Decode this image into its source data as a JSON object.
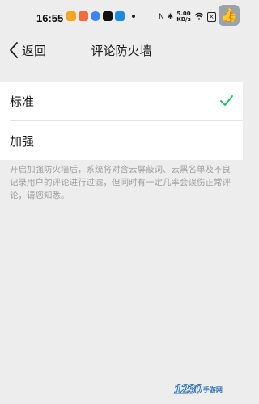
{
  "status_bar": {
    "time": "16:55",
    "network_speed": "5.00\nKB/s",
    "battery": "32"
  },
  "nav": {
    "back_label": "返回",
    "title": "评论防火墙"
  },
  "options": [
    {
      "label": "标准",
      "selected": true
    },
    {
      "label": "加强",
      "selected": false
    }
  ],
  "description": "开启加强防火墙后，系统将对含云屏蔽词、云黑名单及不良记录用户的评论进行过滤，但同时有一定几率会误伤正常评论，请您知悉。",
  "watermark": {
    "number": "1230",
    "text": "手游网"
  },
  "colors": {
    "accent_check": "#07c160",
    "background": "#ededed"
  }
}
